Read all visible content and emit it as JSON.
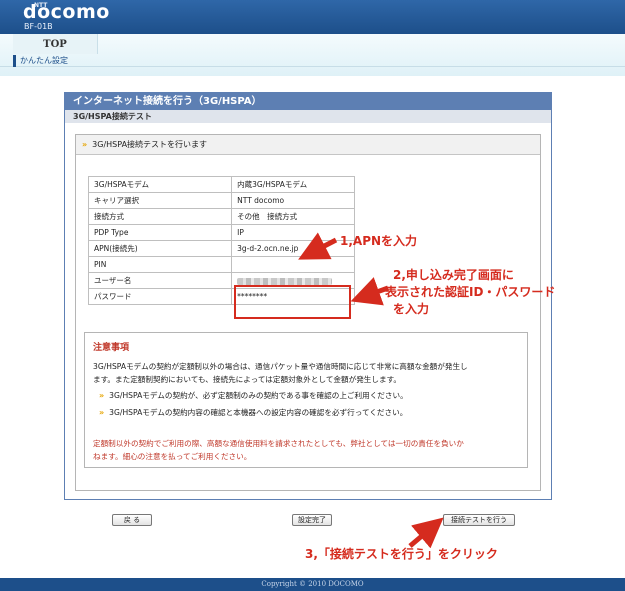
{
  "header": {
    "brand_small": "NTT",
    "brand": "docomo",
    "model": "BF-01B"
  },
  "nav": {
    "top_tab": "TOP",
    "easy_setup": "かんたん設定"
  },
  "panel": {
    "title": "インターネット接続を行う（3G/HSPA）",
    "subtitle": "3G/HSPA接続テスト",
    "section_head": "3G/HSPA接続テストを行います"
  },
  "settings": [
    {
      "key": "3G/HSPAモデム",
      "value": "内蔵3G/HSPAモデム"
    },
    {
      "key": "キャリア選択",
      "value": "NTT docomo"
    },
    {
      "key": "接続方式",
      "value": "その他　接続方式"
    },
    {
      "key": "PDP Type",
      "value": "IP"
    },
    {
      "key": "APN(接続先)",
      "value": "3g-d-2.ocn.ne.jp"
    },
    {
      "key": "PIN",
      "value": ""
    },
    {
      "key": "ユーザー名",
      "value": ""
    },
    {
      "key": "パスワード",
      "value": "********"
    }
  ],
  "notes": {
    "title": "注意事項",
    "para1_line1": "3G/HSPAモデムの契約が定額制以外の場合は、通信パケット量や通信時間に応じて非常に高額な金額が発生し",
    "para1_line2": "ます。また定額制契約においても、接続先によっては定額対象外として金額が発生します。",
    "bullet1": "3G/HSPAモデムの契約が、必ず定額制のみの契約である事を確認の上ご利用ください。",
    "bullet2": "3G/HSPAモデムの契約内容の確認と本機器への設定内容の確認を必ず行ってください。",
    "warning_line1": "定額制以外の契約でご利用の際、高額な通信使用料を請求されたとしても、弊社としては一切の責任を負いか",
    "warning_line2": "ねます。細心の注意を払ってご利用ください。"
  },
  "buttons": {
    "back": "戻 る",
    "complete": "設定完了",
    "test": "接続テストを行う"
  },
  "annotations": {
    "a1": "1,APNを入力",
    "a2_line1": "2,申し込み完了画面に",
    "a2_line2": "表示された認証ID・パスワード",
    "a2_line3": "を入力",
    "a3": "3,「接続テストを行う」をクリック"
  },
  "footer": {
    "copyright": "Copyright © 2010 DOCOMO"
  },
  "colors": {
    "brand_blue": "#1d4f8a",
    "panel_blue": "#5d7fb3",
    "annotation_red": "#d52b1e",
    "accent_orange": "#e6a400"
  }
}
